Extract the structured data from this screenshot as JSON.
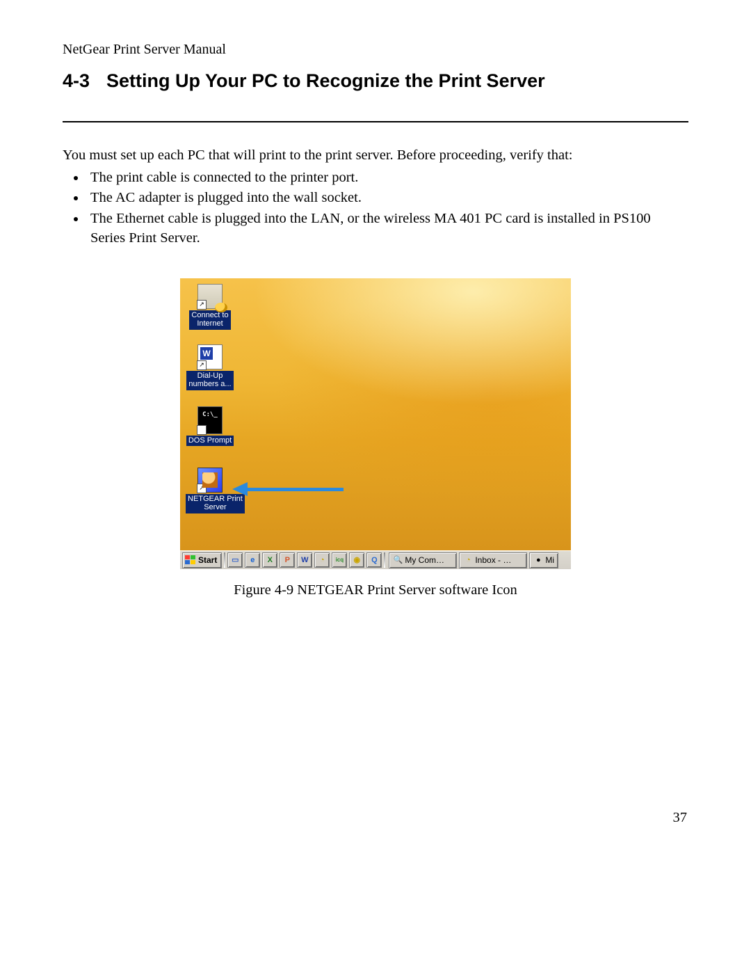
{
  "doc": {
    "running_header": "NetGear Print Server Manual",
    "section_number": "4-3",
    "section_title": "Setting Up Your PC to Recognize the Print Server",
    "intro": "You must set up each PC that will print to the print server. Before proceeding, verify that:",
    "bullets": [
      "The print cable is connected to the printer port.",
      "The AC adapter is plugged into the wall socket.",
      "The Ethernet cable is plugged into the LAN, or the wireless MA 401 PC card is installed in PS100 Series Print Server."
    ],
    "figure_caption": "Figure 4-9 NETGEAR Print Server software Icon",
    "page_number": "37"
  },
  "screenshot": {
    "icons": [
      {
        "id": "connect-to-internet",
        "label": "Connect to\nInternet",
        "shortcut": true
      },
      {
        "id": "dial-up-numbers",
        "label": "Dial-Up\nnumbers a...",
        "shortcut": true
      },
      {
        "id": "dos-prompt",
        "label": "DOS Prompt",
        "dos_text": "C:\\_",
        "shortcut": true
      },
      {
        "id": "netgear-print-server",
        "label": "NETGEAR Print\nServer",
        "shortcut": true,
        "highlighted": true
      }
    ],
    "shortcut_glyph": "↗",
    "taskbar": {
      "start_label": "Start",
      "quicklaunch": [
        {
          "id": "show-desktop",
          "glyph": "▭",
          "color": "#3a66c8"
        },
        {
          "id": "ie",
          "glyph": "e",
          "color": "#1460d2"
        },
        {
          "id": "excel",
          "glyph": "X",
          "color": "#1f7d22"
        },
        {
          "id": "powerpoint",
          "glyph": "P",
          "color": "#d4552c"
        },
        {
          "id": "word",
          "glyph": "W",
          "color": "#1e3ea8"
        },
        {
          "id": "outlook",
          "glyph": "◔",
          "color": "#caa400"
        },
        {
          "id": "icq",
          "glyph": "icq",
          "color": "#2a8a2a"
        },
        {
          "id": "media-player",
          "glyph": "◉",
          "color": "#caa400"
        },
        {
          "id": "quicktime",
          "glyph": "Q",
          "color": "#2a6ad0"
        }
      ],
      "tasks": [
        {
          "id": "my-computer",
          "glyph": "🔍",
          "label": "My Com…"
        },
        {
          "id": "inbox",
          "glyph": "◔",
          "label": "Inbox - …"
        },
        {
          "id": "mi",
          "glyph": "●",
          "label": "Mi"
        }
      ]
    }
  }
}
